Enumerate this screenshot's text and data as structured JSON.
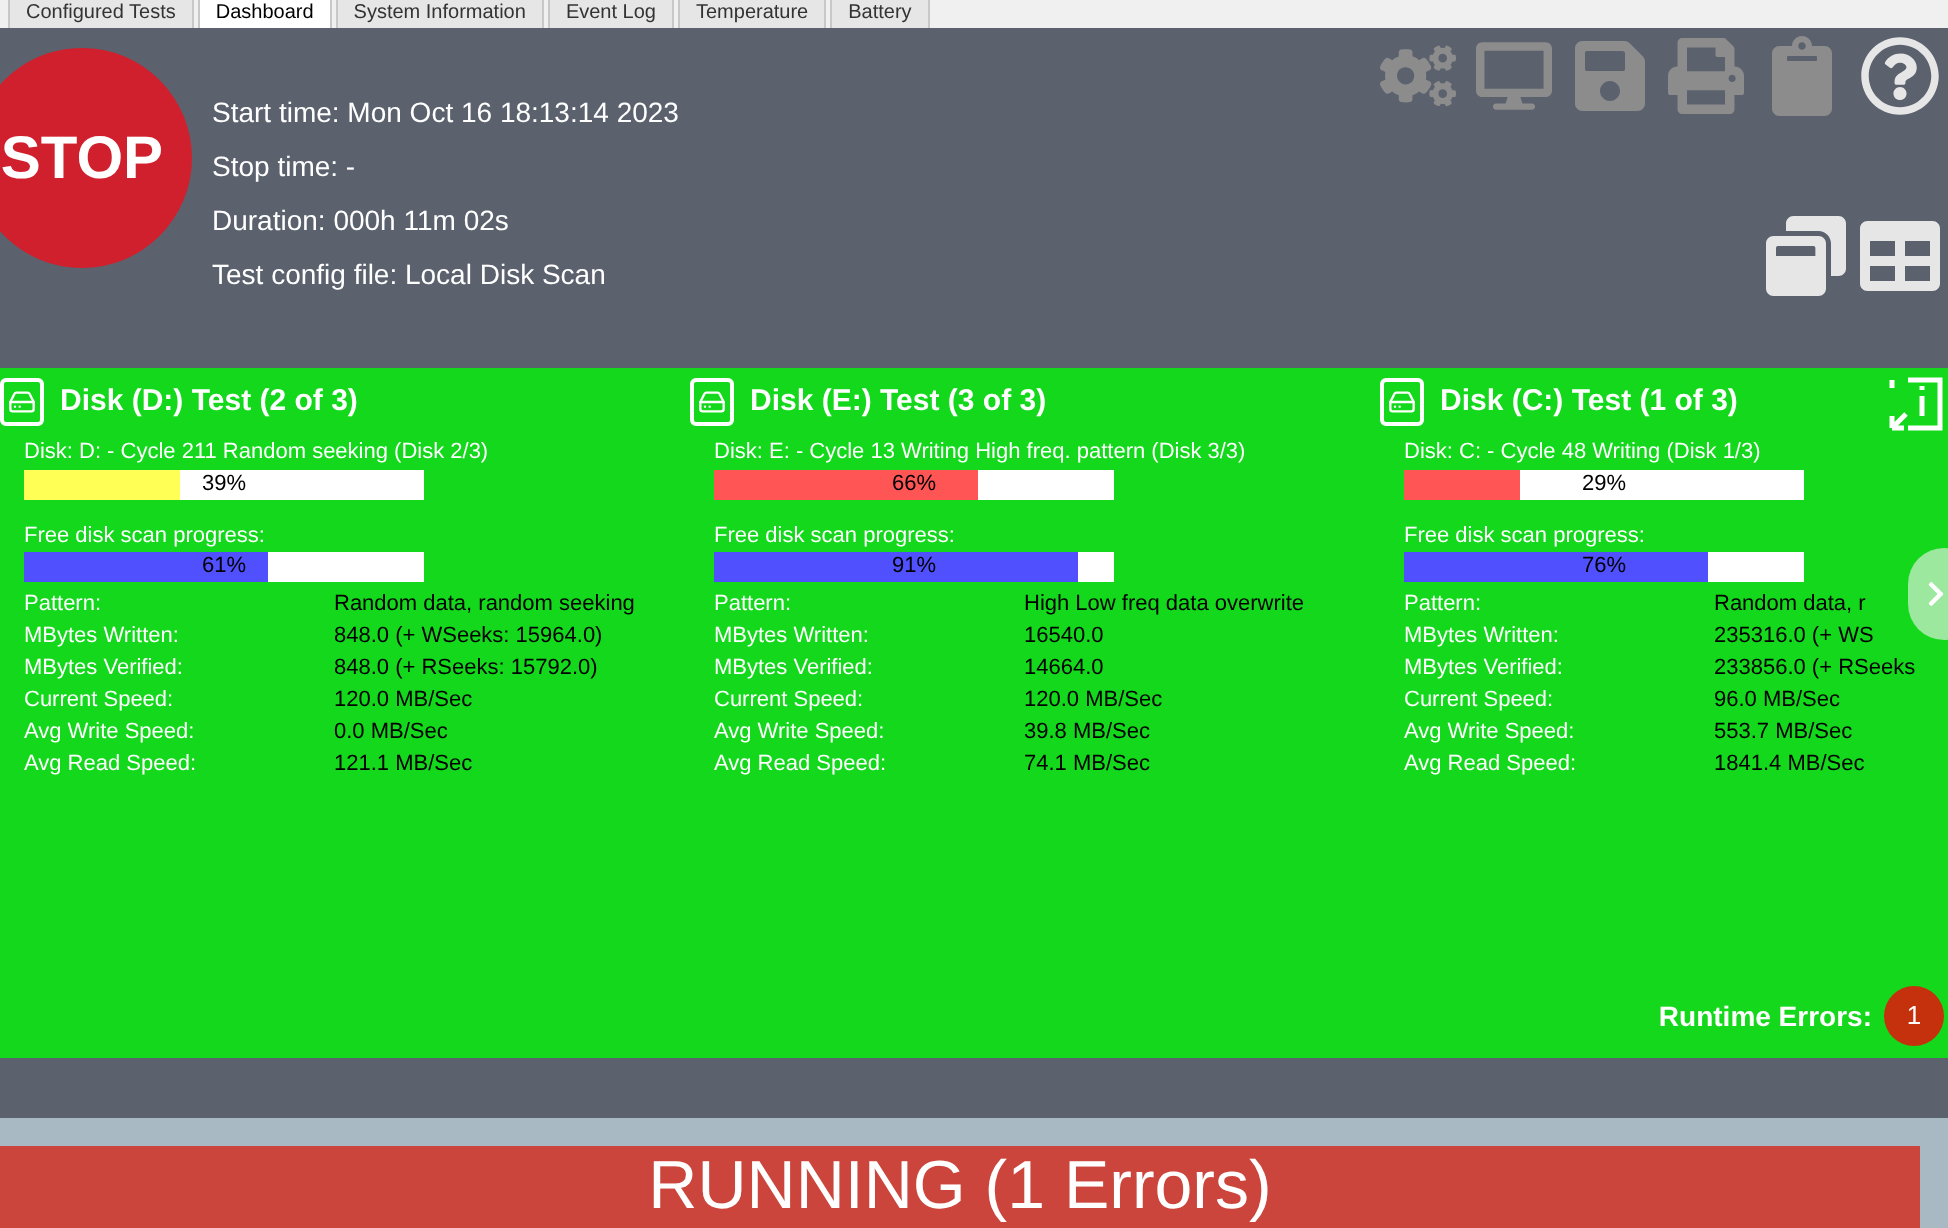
{
  "tabs": [
    {
      "label": "Configured Tests",
      "selected": false
    },
    {
      "label": "Dashboard",
      "selected": true
    },
    {
      "label": "System Information",
      "selected": false
    },
    {
      "label": "Event Log",
      "selected": false
    },
    {
      "label": "Temperature",
      "selected": false
    },
    {
      "label": "Battery",
      "selected": false
    }
  ],
  "stop_button": "STOP",
  "info": [
    "Start time: Mon Oct 16 18:13:14 2023",
    "Stop time: -",
    "Duration: 000h 11m 02s",
    "Test config file: Local Disk Scan"
  ],
  "disks": [
    {
      "title": "Disk (D:) Test (2 of 3)",
      "cycle": {
        "label": "Disk: D: - Cycle 211 Random seeking (Disk 2/3)",
        "level": 0.39,
        "reading": "39%",
        "color": "#ffff55"
      },
      "scan": {
        "label": "Free disk scan progress:",
        "level": 0.61,
        "reading": "61%"
      },
      "stats": [
        [
          "Pattern:",
          "Random data, random seeking"
        ],
        [
          "MBytes Written:",
          "848.0 (+ WSeeks: 15964.0)"
        ],
        [
          "MBytes Verified:",
          "848.0 (+ RSeeks: 15792.0)"
        ],
        [
          "Current Speed:",
          "120.0 MB/Sec"
        ],
        [
          "Avg Write Speed:",
          "0.0 MB/Sec"
        ],
        [
          "Avg Read Speed:",
          "121.1 MB/Sec"
        ]
      ]
    },
    {
      "title": "Disk (E:) Test (3 of 3)",
      "cycle": {
        "label": "Disk: E: - Cycle 13 Writing High freq. pattern (Disk 3/3)",
        "level": 0.66,
        "reading": "66%",
        "color": "#ff5555"
      },
      "scan": {
        "label": "Free disk scan progress:",
        "level": 0.91,
        "reading": "91%"
      },
      "stats": [
        [
          "Pattern:",
          "High Low freq data overwrite"
        ],
        [
          "MBytes Written:",
          "16540.0"
        ],
        [
          "MBytes Verified:",
          "14664.0"
        ],
        [
          "Current Speed:",
          "120.0 MB/Sec"
        ],
        [
          "Avg Write Speed:",
          "39.8 MB/Sec"
        ],
        [
          "Avg Read Speed:",
          "74.1 MB/Sec"
        ]
      ]
    },
    {
      "title": "Disk (C:) Test (1 of 3)",
      "cycle": {
        "label": "Disk: C: - Cycle 48 Writing (Disk 1/3)",
        "level": 0.29,
        "reading": "29%",
        "color": "#ff5555"
      },
      "scan": {
        "label": "Free disk scan progress:",
        "level": 0.76,
        "reading": "76%"
      },
      "stats": [
        [
          "Pattern:",
          "Random data, r"
        ],
        [
          "MBytes Written:",
          "235316.0 (+ WS"
        ],
        [
          "MBytes Verified:",
          "233856.0 (+ RSeeks"
        ],
        [
          "Current Speed:",
          "96.0 MB/Sec"
        ],
        [
          "Avg Write Speed:",
          "553.7 MB/Sec"
        ],
        [
          "Avg Read Speed:",
          "1841.4 MB/Sec"
        ]
      ]
    }
  ],
  "runtime_errors": {
    "label": "Runtime Errors:",
    "count": "1"
  },
  "status": "RUNNING (1 Errors)"
}
